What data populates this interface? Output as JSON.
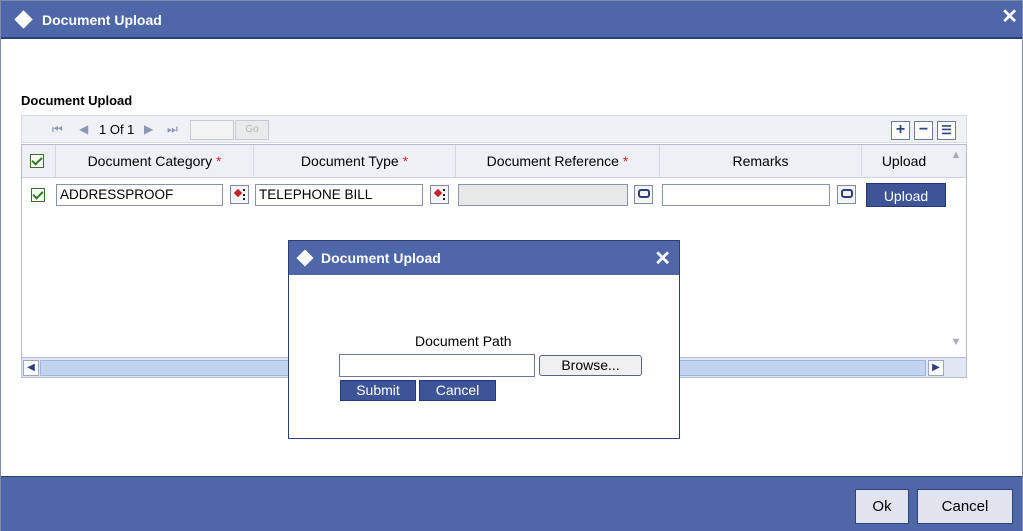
{
  "window": {
    "title": "Document Upload",
    "close_symbol": "✕"
  },
  "section": {
    "title": "Document Upload"
  },
  "pager": {
    "first": "⏮",
    "prev": "◀",
    "record_count": "1 Of 1",
    "next": "▶",
    "last": "⏭",
    "go_label": "Go",
    "add_icon": "plus-icon",
    "delete_icon": "minus-icon",
    "view_icon": "list-icon"
  },
  "grid": {
    "columns": [
      {
        "label": "Document Category",
        "required": true
      },
      {
        "label": "Document Type",
        "required": true
      },
      {
        "label": "Document Reference",
        "required": true
      },
      {
        "label": "Remarks",
        "required": false
      },
      {
        "label": "Upload",
        "required": false
      }
    ],
    "required_marker": "*",
    "rows": [
      {
        "checked": true,
        "category": "ADDRESSPROOF",
        "type": "TELEPHONE BILL",
        "reference": "",
        "remarks": "",
        "upload_label": "Upload"
      }
    ]
  },
  "dialog": {
    "title": "Document Upload",
    "close_symbol": "✕",
    "path_label": "Document Path",
    "path_value": "",
    "browse_label": "Browse...",
    "submit_label": "Submit",
    "cancel_label": "Cancel"
  },
  "footer": {
    "ok_label": "Ok",
    "cancel_label": "Cancel"
  },
  "colors": {
    "titlebar": "#4e67a8",
    "button": "#3d5597",
    "required": "#d2262c"
  }
}
